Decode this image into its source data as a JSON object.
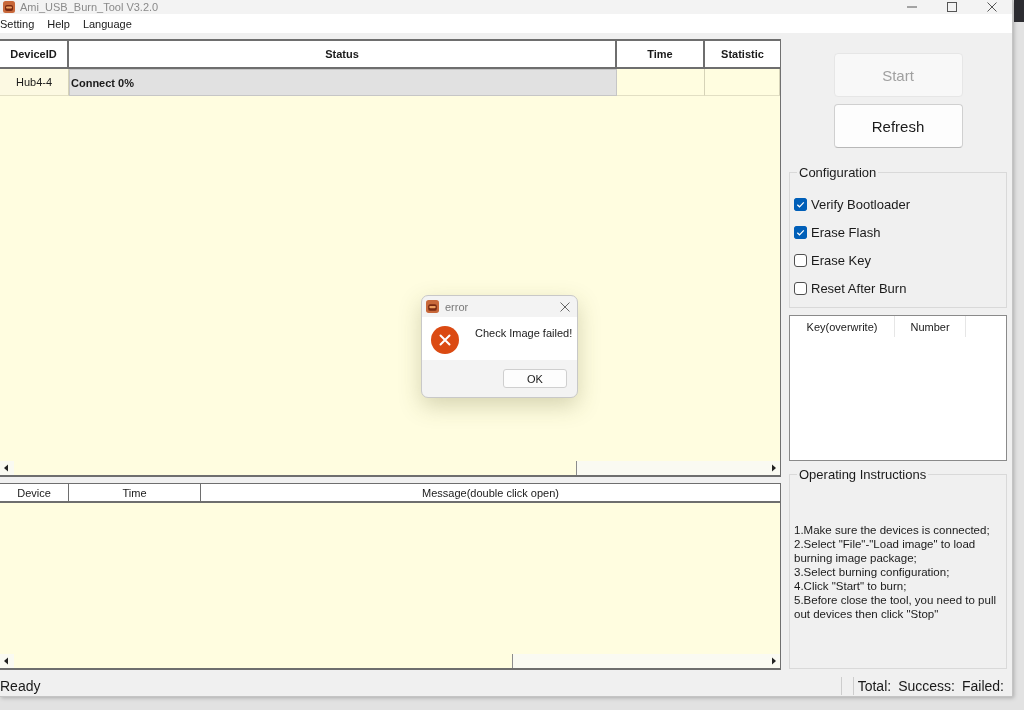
{
  "window": {
    "title": "Ami_USB_Burn_Tool V3.2.0"
  },
  "menu": [
    {
      "label": "Setting"
    },
    {
      "label": "Help"
    },
    {
      "label": "Language"
    }
  ],
  "device_table": {
    "columns": [
      "DeviceID",
      "Status",
      "Time",
      "Statistic"
    ],
    "rows": [
      {
        "device_id": "Hub4-4",
        "status": "Connect 0%"
      }
    ]
  },
  "log_table": {
    "columns": [
      "Device",
      "Time",
      "Message(double click open)"
    ]
  },
  "buttons": [
    {
      "label": "Start",
      "disabled": true
    },
    {
      "label": "Refresh",
      "disabled": false
    }
  ],
  "configuration": {
    "title": "Configuration",
    "options": [
      {
        "label": "Verify Bootloader",
        "checked": true
      },
      {
        "label": "Erase Flash",
        "checked": true
      },
      {
        "label": "Erase Key",
        "checked": false
      },
      {
        "label": "Reset After Burn",
        "checked": false
      }
    ]
  },
  "key_table": {
    "columns": [
      "Key(overwrite)",
      "Number"
    ]
  },
  "instructions": {
    "title": "Operating Instructions",
    "lines": [
      "1.Make sure the devices is connected;",
      "2.Select \"File\"-\"Load image\" to load burning image package;",
      "3.Select burning configuration;",
      "4.Click \"Start\" to burn;",
      "5.Before close the tool, you need to pull out devices then click \"Stop\""
    ]
  },
  "status_bar": {
    "text": "Ready",
    "counters": [
      "Total:",
      "Success:",
      "Failed:"
    ]
  },
  "dialog": {
    "title": "error",
    "message": "Check Image failed!",
    "button": "OK"
  }
}
